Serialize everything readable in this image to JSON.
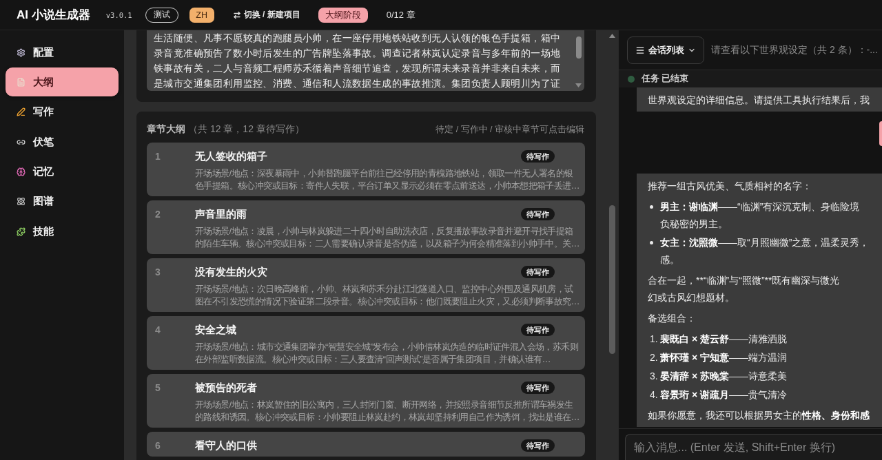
{
  "header": {
    "title": "AI 小说生成器",
    "version": "v3.0.1",
    "env_badge": "测试",
    "language": "ZH",
    "switch_project": "切换 / 新建项目",
    "stage": "大纲阶段",
    "progress": "0/12 章"
  },
  "sidebar": {
    "items": [
      {
        "label": "配置",
        "selected": false
      },
      {
        "label": "大纲",
        "selected": true
      },
      {
        "label": "写作",
        "selected": false
      },
      {
        "label": "伏笔",
        "selected": false
      },
      {
        "label": "记忆",
        "selected": false
      },
      {
        "label": "图谱",
        "selected": false
      },
      {
        "label": "技能",
        "selected": false
      }
    ]
  },
  "synopsis": {
    "text": "生活随便、凡事不愿较真的跑腿员小帅，在一座停用地铁站收到无人认领的银色手提箱，箱中录音竟准确预告了数小时后发生的广告牌坠落事故。调查记者林岚认定录音与多年前的一场地铁事故有关，二人与音频工程师苏禾循着声音细节追查，发现所谓未来录音并非来自未来，而是城市交通集团利用监控、消费、通信和人流数据生成的事故推演。集团负责人顾明川为了证"
  },
  "chapter_outline": {
    "title": "章节大纲",
    "summary": "（共 12 章，12 章待写作）",
    "hint": "待定 / 写作中 / 审核中章节可点击编辑",
    "chapters": [
      {
        "number": "1",
        "title": "无人签收的箱子",
        "status": "待写作",
        "description": "开场场景/地点：深夜暴雨中，小帅替跑腿平台前往已经停用的青槐路地铁站，领取一件无人署名的银色手提箱。核心冲突或目标：寄件人失联，平台订单又显示必须在零点前送达，小帅本想把箱子丢进…"
      },
      {
        "number": "2",
        "title": "声音里的雨",
        "status": "待写作",
        "description": "开场场景/地点：凌晨，小帅与林岚躲进二十四小时自助洗衣店，反复播放事故录音并避开寻找手提箱的陌生车辆。核心冲突或目标：二人需要确认录音是否伪造，以及箱子为何会精准落到小帅手中。关…"
      },
      {
        "number": "3",
        "title": "没有发生的火灾",
        "status": "待写作",
        "description": "开场场景/地点：次日晚高峰前，小帅、林岚和苏禾分赴江北隧道入口、监控中心外围及通风机房，试图在不引发恐慌的情况下验证第二段录音。核心冲突或目标：他们既要阻止火灾，又必须判断事故究…"
      },
      {
        "number": "4",
        "title": "安全之城",
        "status": "待写作",
        "description": "开场场景/地点：城市交通集团举办“智慧安全城”发布会，小帅借林岚伪造的临时证件混入会场，苏禾则在外部监听数据流。核心冲突或目标：三人要查清“回声测试”是否属于集团项目，并确认谁有…"
      },
      {
        "number": "5",
        "title": "被预告的死者",
        "status": "待写作",
        "description": "开场场景/地点：林岚暂住的旧公寓内，三人封闭门窗、断开网络，并按照录音细节反推所谓车祸发生的路线和诱因。核心冲突或目标：小帅要阻止林岚赴约，林岚却坚持利用自己作为诱饵，找出是谁在…"
      },
      {
        "number": "6",
        "title": "看守人的口供",
        "status": "待写作"
      }
    ]
  },
  "chat": {
    "session_button": "会话列表",
    "session_title": "请查看以下世界观设定（共 2 条）：-...",
    "task_status": "任务 已结束",
    "messages": [
      {
        "kind": "assistant",
        "blocks": [
          {
            "kind": "paragraph",
            "lines": [
              "世界观设定的详细信息。请提供工具执行结果后，我"
            ]
          }
        ]
      },
      {
        "kind": "user"
      },
      {
        "kind": "assistant",
        "blocks": [
          {
            "kind": "paragraph",
            "lines": [
              "推荐一组古风优美、气质相衬的名字："
            ]
          },
          {
            "kind": "bullets",
            "items": [
              {
                "lines": [
                  "**男主：谢临渊**——“临渊”有深沉克制、身临险境",
                  "负秘密的男主。"
                ]
              },
              {
                "lines": [
                  "**女主：沈照微**——取“月照幽微”之意，温柔灵秀，",
                  "感。"
                ]
              }
            ]
          },
          {
            "kind": "raw",
            "lines": [
              "合在一起，**“临渊”与“照微”**既有幽深与微光",
              "幻或古风幻想题材。"
            ]
          },
          {
            "kind": "paragraph",
            "lines": [
              "备选组合："
            ]
          },
          {
            "kind": "numbered",
            "items": [
              {
                "number": "1.",
                "lines": [
                  "**裴既白 × 楚云舒**——清雅洒脱"
                ]
              },
              {
                "number": "2.",
                "lines": [
                  "**萧怀瑾 × 宁知意**——端方温润"
                ]
              },
              {
                "number": "3.",
                "lines": [
                  "**晏清辞 × 苏晚棠**——诗意柔美"
                ]
              },
              {
                "number": "4.",
                "lines": [
                  "**容景珩 × 谢疏月**——贵气清冷"
                ]
              }
            ]
          },
          {
            "kind": "paragraph",
            "lines": [
              "如果你愿意，我还可以根据男女主的**性格、身份和感**"
            ]
          }
        ]
      }
    ],
    "input_placeholder": "输入消息... (Enter 发送, Shift+Enter 换行)"
  }
}
